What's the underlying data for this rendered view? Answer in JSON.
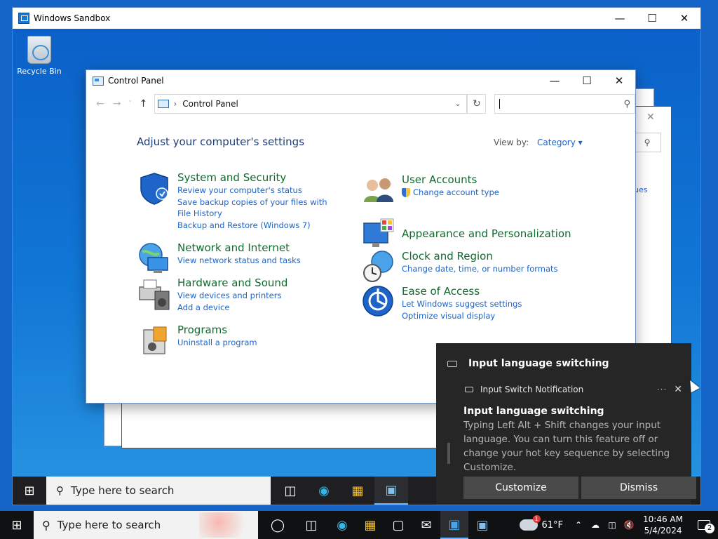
{
  "host": {
    "taskbar": {
      "search_placeholder": "Type here to search",
      "weather_temp": "61°F",
      "weather_badge": "1",
      "clock_time": "10:46 AM",
      "clock_date": "5/4/2024",
      "notification_count": "2"
    }
  },
  "sandbox": {
    "title": "Windows Sandbox",
    "desktop": {
      "recycle_bin_label": "Recycle Bin"
    },
    "background_link": "ues",
    "taskbar": {
      "search_placeholder": "Type here to search"
    }
  },
  "control_panel": {
    "title": "Control Panel",
    "address": "Control Panel",
    "search_value": "",
    "heading": "Adjust your computer's settings",
    "view_by_label": "View by:",
    "view_by_value": "Category",
    "categories_left": [
      {
        "title": "System and Security",
        "icon": "shield-icon",
        "links": [
          "Review your computer's status",
          "Save backup copies of your files with File History",
          "Backup and Restore (Windows 7)"
        ]
      },
      {
        "title": "Network and Internet",
        "icon": "globe-network-icon",
        "links": [
          "View network status and tasks"
        ]
      },
      {
        "title": "Hardware and Sound",
        "icon": "printer-speaker-icon",
        "links": [
          "View devices and printers",
          "Add a device"
        ]
      },
      {
        "title": "Programs",
        "icon": "programs-box-icon",
        "links": [
          "Uninstall a program"
        ]
      }
    ],
    "categories_right": [
      {
        "title": "User Accounts",
        "icon": "users-icon",
        "links": [
          "Change account type"
        ]
      },
      {
        "title": "Appearance and Personalization",
        "icon": "monitor-palette-icon",
        "links": []
      },
      {
        "title": "Clock and Region",
        "icon": "clock-globe-icon",
        "links": [
          "Change date, time, or number formats"
        ]
      },
      {
        "title": "Ease of Access",
        "icon": "ease-of-access-icon",
        "links": [
          "Let Windows suggest settings",
          "Optimize visual display"
        ]
      }
    ]
  },
  "notification": {
    "group_title": "Input language switching",
    "app_name": "Input Switch Notification",
    "title": "Input language switching",
    "body": "Typing Left Alt + Shift changes your input language. You can turn this feature off or change your hot key sequence by selecting Customize.",
    "more": "···",
    "actions": [
      "Customize",
      "Dismiss"
    ]
  }
}
